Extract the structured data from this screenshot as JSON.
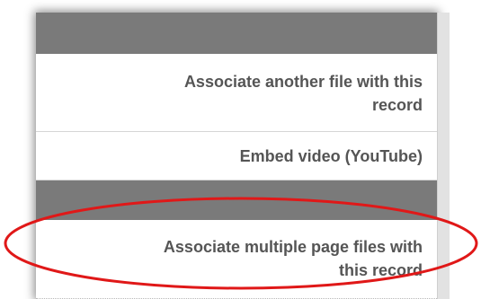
{
  "menu": {
    "items": [
      {
        "line1": "Associate another file with this",
        "line2": "record"
      },
      {
        "line1": "Embed video (YouTube)"
      },
      {
        "line1": "Associate multiple page files with",
        "line2": "this record"
      }
    ]
  },
  "colors": {
    "header_bar": "#7a7a7a",
    "item_text": "#555555",
    "highlight_ellipse": "#e01818"
  }
}
